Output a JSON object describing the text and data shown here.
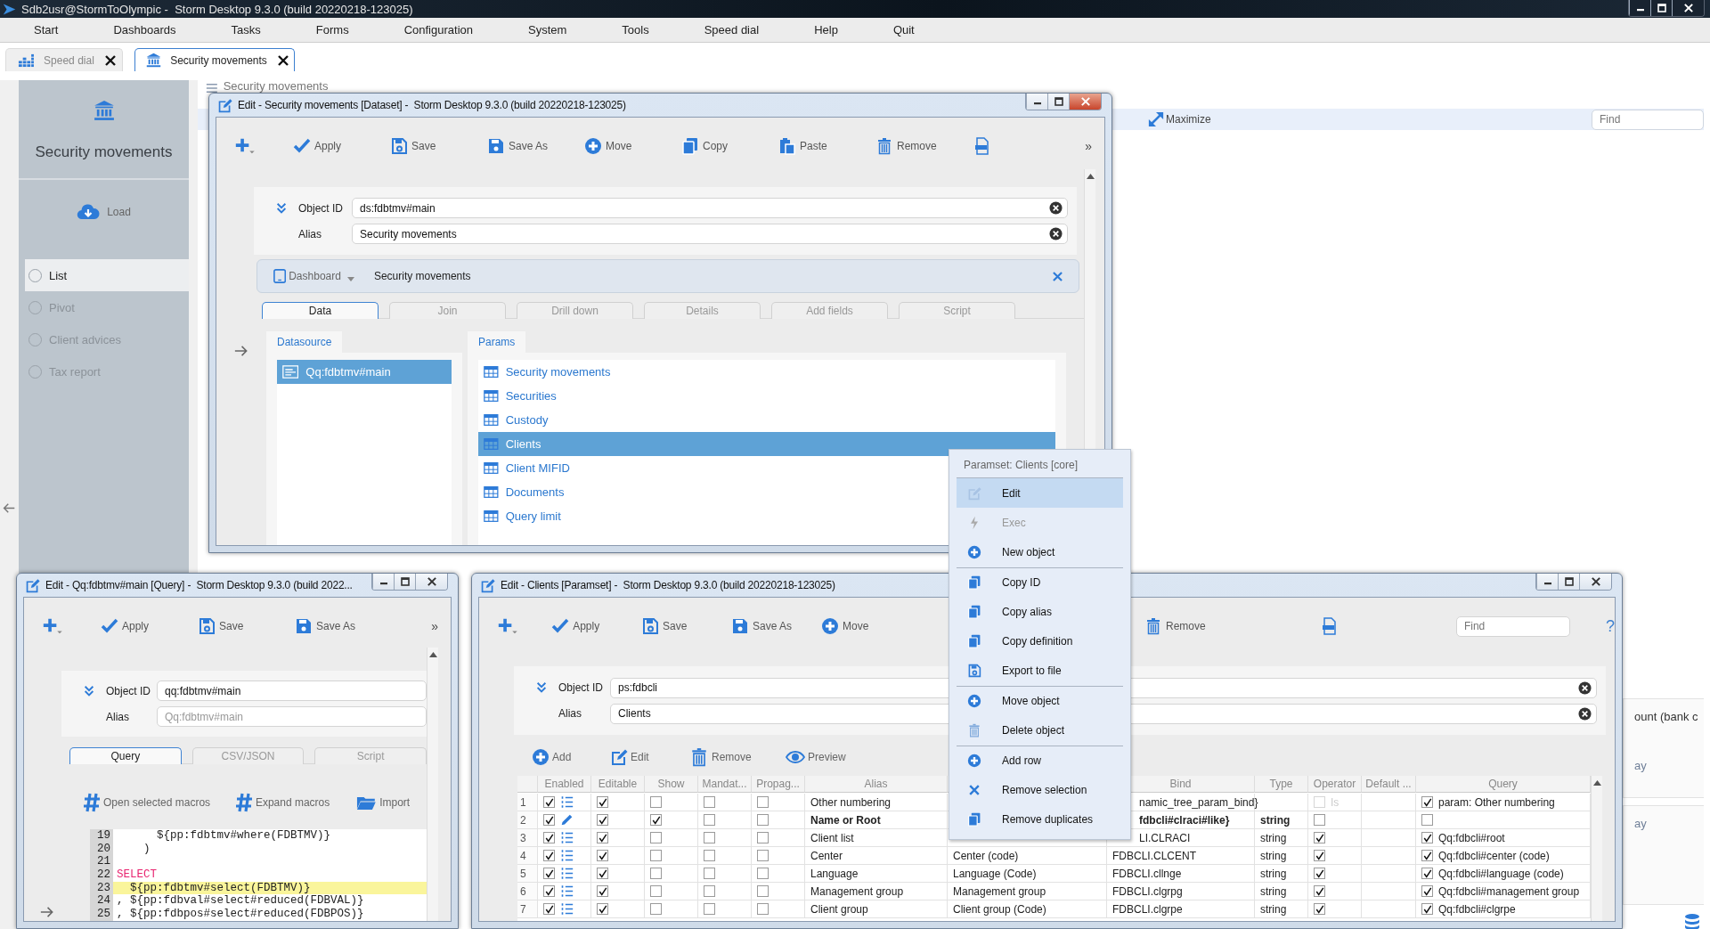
{
  "app_window": {
    "title": "Sdb2usr@StormToOlympic -  Storm Desktop 9.3.0 (build 20220218-123025)"
  },
  "menu": [
    "Start",
    "Dashboards",
    "Tasks",
    "Forms",
    "Configuration",
    "System",
    "Tools",
    "Speed dial",
    "Help",
    "Quit"
  ],
  "tabs": [
    {
      "label": "Speed dial",
      "kind": "speed-dial",
      "selected": false
    },
    {
      "label": "Security movements",
      "kind": "module",
      "selected": true
    }
  ],
  "sidebar": {
    "title": "Security movements",
    "load": "Load",
    "views": [
      {
        "label": "List",
        "selected": true
      },
      {
        "label": "Pivot",
        "selected": false
      },
      {
        "label": "Client advices",
        "selected": false
      },
      {
        "label": "Tax report",
        "selected": false
      }
    ]
  },
  "page": {
    "title": "Security movements",
    "maximize": "Maximize",
    "find_placeholder": "Find",
    "panels": [
      {
        "lines": [
          {
            "text": "ount (bank c",
            "faded": false
          },
          {
            "text": "ay",
            "faded": true
          }
        ]
      },
      {
        "lines": [
          {
            "text": "ay",
            "faded": true
          }
        ]
      }
    ]
  },
  "dataset_window": {
    "title": "Edit - Security movements [Dataset] -  Storm Desktop 9.3.0 (build 20220218-123025)",
    "toolbar": [
      {
        "kind": "new"
      },
      {
        "kind": "apply",
        "label": "Apply"
      },
      {
        "kind": "save",
        "label": "Save"
      },
      {
        "kind": "save-as",
        "label": "Save As"
      },
      {
        "kind": "move",
        "label": "Move"
      },
      {
        "kind": "copy",
        "label": "Copy"
      },
      {
        "kind": "paste",
        "label": "Paste"
      },
      {
        "kind": "remove",
        "label": "Remove"
      },
      {
        "kind": "xml"
      }
    ],
    "overflow": "»",
    "id_label": "Object ID",
    "object_id": "ds:fdbtmv#main",
    "alias_label": "Alias",
    "alias": "Security movements",
    "dashboard": {
      "label": "Dashboard",
      "value": "Security movements"
    },
    "tabs": [
      {
        "label": "Data",
        "selected": true
      },
      {
        "label": "Join",
        "selected": false
      },
      {
        "label": "Drill down",
        "selected": false
      },
      {
        "label": "Details",
        "selected": false
      },
      {
        "label": "Add fields",
        "selected": false
      },
      {
        "label": "Script",
        "selected": false
      }
    ],
    "datasource": {
      "label": "Datasource",
      "items": [
        {
          "label": "Qq:fdbtmv#main",
          "selected": true
        }
      ]
    },
    "params": {
      "label": "Params",
      "items": [
        {
          "label": "Security movements",
          "selected": false
        },
        {
          "label": "Securities",
          "selected": false
        },
        {
          "label": "Custody",
          "selected": false
        },
        {
          "label": "Clients",
          "selected": true
        },
        {
          "label": "Client MIFID",
          "selected": false
        },
        {
          "label": "Documents",
          "selected": false
        },
        {
          "label": "Query limit",
          "selected": false
        }
      ]
    }
  },
  "query_window": {
    "title": "Edit - Qq:fdbtmv#main [Query] -  Storm Desktop 9.3.0 (build 2022...",
    "toolbar": [
      {
        "kind": "new"
      },
      {
        "kind": "apply",
        "label": "Apply"
      },
      {
        "kind": "save",
        "label": "Save"
      },
      {
        "kind": "save-as",
        "label": "Save As"
      }
    ],
    "overflow": "»",
    "id_label": "Object ID",
    "object_id": "qq:fdbtmv#main",
    "alias_label": "Alias",
    "alias_placeholder": "Qq:fdbtmv#main",
    "tabs": [
      {
        "label": "Query",
        "selected": true
      },
      {
        "label": "CSV/JSON",
        "selected": false
      },
      {
        "label": "Script",
        "selected": false
      }
    ],
    "actions": [
      {
        "kind": "macro",
        "label": "Open selected macros"
      },
      {
        "kind": "macro",
        "label": "Expand macros"
      },
      {
        "kind": "import",
        "label": "Import"
      }
    ],
    "code": [
      {
        "number": "19",
        "kind": "code",
        "text": "      ${pp:fdbtmv#where(FDBTMV)}",
        "highlighted": false
      },
      {
        "number": "20",
        "kind": "code",
        "text": "    )",
        "highlighted": false
      },
      {
        "number": "21",
        "kind": "code",
        "highlighted": false
      },
      {
        "number": "22",
        "kind": "keyword",
        "text": "SELECT",
        "highlighted": false
      },
      {
        "number": "23",
        "kind": "code",
        "text": "  ${pp:fdbtmv#select(FDBTMV)}",
        "highlighted": true
      },
      {
        "number": "24",
        "kind": "code",
        "text": ", ${pp:fdbval#select#reduced(FDBVAL)}",
        "highlighted": false
      },
      {
        "number": "25",
        "kind": "code",
        "text": ", ${pp:fdbpos#select#reduced(FDBPOS)}",
        "highlighted": false
      }
    ]
  },
  "clients_window": {
    "title": "Edit - Clients [Paramset] -  Storm Desktop 9.3.0 (build 20220218-123025)",
    "toolbar": [
      {
        "kind": "new"
      },
      {
        "kind": "apply",
        "label": "Apply"
      },
      {
        "kind": "save",
        "label": "Save"
      },
      {
        "kind": "save-as",
        "label": "Save As"
      },
      {
        "kind": "move",
        "label": "Move"
      },
      {
        "kind": "remove",
        "label": "Remove"
      },
      {
        "kind": "xml"
      }
    ],
    "find_placeholder": "Find",
    "help": "?",
    "id_label": "Object ID",
    "object_id": "ps:fdbcli",
    "alias_label": "Alias",
    "alias": "Clients",
    "actions": [
      {
        "kind": "add",
        "label": "Add"
      },
      {
        "kind": "edit",
        "label": "Edit"
      },
      {
        "kind": "remove",
        "label": "Remove"
      },
      {
        "kind": "preview",
        "label": "Preview"
      }
    ],
    "columns": [
      "Enabled",
      "Editable",
      "Show",
      "Mandat...",
      "Propag...",
      "Alias",
      "Bind",
      "Type",
      "Operator",
      "Default ...",
      "Query"
    ],
    "rows": [
      {
        "number": "1",
        "enabled": true,
        "kind": "list",
        "editable": true,
        "show": false,
        "mandatory": false,
        "propagate": false,
        "alias": "Other numbering",
        "emphasized": false,
        "bind": "namic_tree_param_bind}",
        "bind_clipped": true,
        "operator": false,
        "operator_disabled": true,
        "operator_label": "Is",
        "query_checked": true,
        "query": "param: Other numbering"
      },
      {
        "number": "2",
        "enabled": true,
        "kind": "edit",
        "editable": true,
        "show": true,
        "mandatory": false,
        "propagate": false,
        "alias": "Name or Root",
        "emphasized": true,
        "bind": "fdbcli#clraci#like}",
        "bind_clipped": true,
        "type": "string",
        "operator": false,
        "operator_disabled": false,
        "query_checked": false
      },
      {
        "number": "3",
        "enabled": true,
        "kind": "list",
        "editable": true,
        "show": false,
        "mandatory": false,
        "propagate": false,
        "alias": "Client list",
        "emphasized": false,
        "bind": "LI.CLRACI",
        "bind_clipped": true,
        "type": "string",
        "operator": true,
        "operator_disabled": false,
        "query_checked": true,
        "query": "Qq:fdbcli#root"
      },
      {
        "number": "4",
        "enabled": true,
        "kind": "list",
        "editable": true,
        "show": false,
        "mandatory": false,
        "propagate": false,
        "alias": "Center",
        "emphasized": false,
        "description": "Center (code)",
        "bind": "FDBCLI.CLCENT",
        "bind_clipped": false,
        "type": "string",
        "operator": true,
        "operator_disabled": false,
        "query_checked": true,
        "query": "Qq:fdbcli#center (code)"
      },
      {
        "number": "5",
        "enabled": true,
        "kind": "list",
        "editable": true,
        "show": false,
        "mandatory": false,
        "propagate": false,
        "alias": "Language",
        "emphasized": false,
        "description": "Language (Code)",
        "bind": "FDBCLI.cllnge",
        "bind_clipped": false,
        "type": "string",
        "operator": true,
        "operator_disabled": false,
        "query_checked": true,
        "query": "Qq:fdbcli#language (code)"
      },
      {
        "number": "6",
        "enabled": true,
        "kind": "list",
        "editable": true,
        "show": false,
        "mandatory": false,
        "propagate": false,
        "alias": "Management group",
        "emphasized": false,
        "description": "Management group",
        "bind": "FDBCLI.clgrpg",
        "bind_clipped": false,
        "type": "string",
        "operator": true,
        "operator_disabled": false,
        "query_checked": true,
        "query": "Qq:fdbcli#management group"
      },
      {
        "number": "7",
        "enabled": true,
        "kind": "list",
        "editable": true,
        "show": false,
        "mandatory": false,
        "propagate": false,
        "alias": "Client group",
        "emphasized": false,
        "description": "Client group  (Code)",
        "bind": "FDBCLI.clgrpe",
        "bind_clipped": false,
        "type": "string",
        "operator": true,
        "operator_disabled": false,
        "query_checked": true,
        "query": "Qq:fdbcli#clgrpe"
      }
    ]
  },
  "context_menu": {
    "title": "Paramset: Clients [core]",
    "items": [
      {
        "label": "Edit",
        "kind": "edit",
        "selected": true,
        "disabled": false,
        "separator_before": false
      },
      {
        "label": "Exec",
        "kind": "exec",
        "selected": false,
        "disabled": true,
        "separator_before": false
      },
      {
        "label": "New object",
        "kind": "add",
        "selected": false,
        "disabled": false,
        "separator_before": false
      },
      {
        "label": "Copy ID",
        "kind": "copy",
        "selected": false,
        "disabled": false,
        "separator_before": true
      },
      {
        "label": "Copy alias",
        "kind": "copy",
        "selected": false,
        "disabled": false,
        "separator_before": false
      },
      {
        "label": "Copy definition",
        "kind": "copy",
        "selected": false,
        "disabled": false,
        "separator_before": false
      },
      {
        "label": "Export to file",
        "kind": "save",
        "selected": false,
        "disabled": false,
        "separator_before": false
      },
      {
        "label": "Move object",
        "kind": "add",
        "selected": false,
        "disabled": false,
        "separator_before": true
      },
      {
        "label": "Delete object",
        "kind": "delete",
        "selected": false,
        "disabled": false,
        "separator_before": false
      },
      {
        "label": "Add row",
        "kind": "add",
        "selected": false,
        "disabled": false,
        "separator_before": true
      },
      {
        "label": "Remove selection",
        "kind": "cross",
        "selected": false,
        "disabled": false,
        "separator_before": false
      },
      {
        "label": "Remove duplicates",
        "kind": "copy",
        "selected": false,
        "disabled": false,
        "separator_before": false
      }
    ]
  }
}
